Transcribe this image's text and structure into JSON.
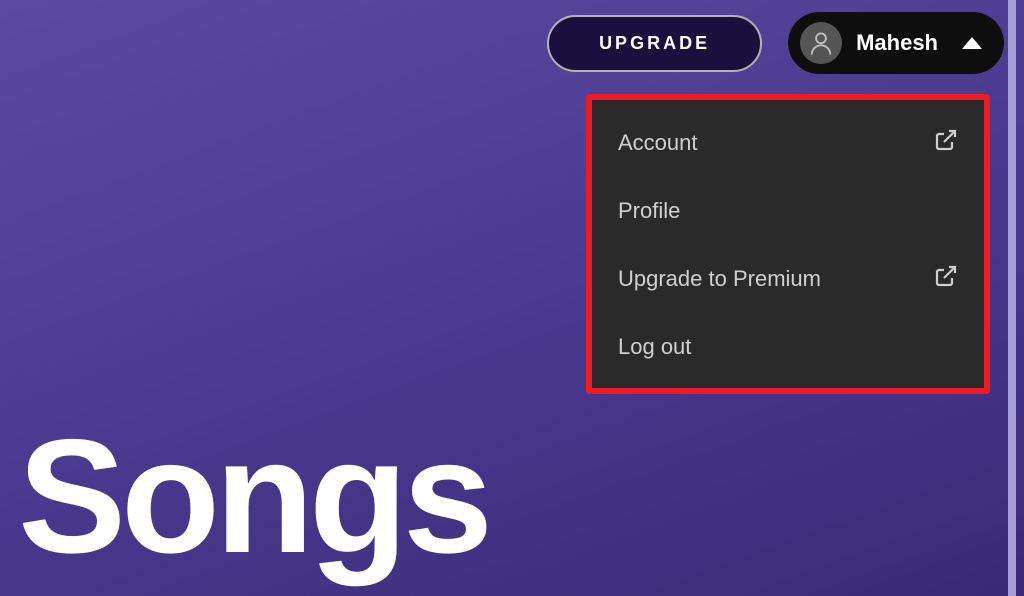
{
  "header": {
    "upgrade_label": "UPGRADE",
    "user_name": "Mahesh"
  },
  "menu": {
    "items": [
      {
        "label": "Account",
        "external": true
      },
      {
        "label": "Profile",
        "external": false
      },
      {
        "label": "Upgrade to Premium",
        "external": true
      },
      {
        "label": "Log out",
        "external": false
      }
    ]
  },
  "page": {
    "title": "Songs"
  }
}
